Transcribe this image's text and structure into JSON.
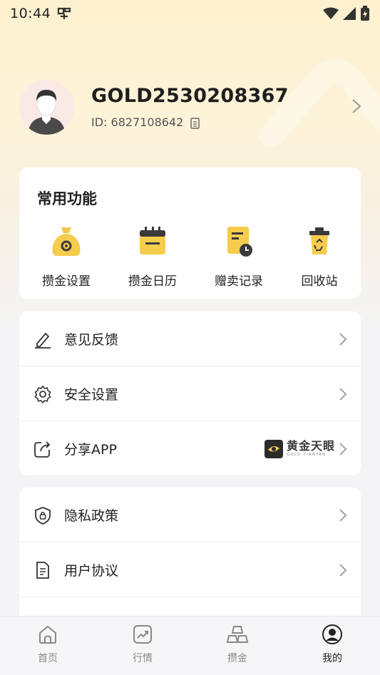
{
  "status": {
    "time": "10:44",
    "notif_icon": "app-notification-icon"
  },
  "profile": {
    "name": "GOLD2530208367",
    "id_text": "ID: 6827108642"
  },
  "common": {
    "title": "常用功能",
    "items": [
      {
        "label": "攒金设置",
        "icon": "money-bag-gear-icon"
      },
      {
        "label": "攒金日历",
        "icon": "calendar-icon"
      },
      {
        "label": "赠卖记录",
        "icon": "record-clock-icon"
      },
      {
        "label": "回收站",
        "icon": "recycle-bin-icon"
      }
    ]
  },
  "menu1": [
    {
      "label": "意见反馈",
      "icon": "pen-icon"
    },
    {
      "label": "安全设置",
      "icon": "gear-icon"
    },
    {
      "label": "分享APP",
      "icon": "share-icon",
      "brand": "黄金天眼",
      "brand_sub": "GOLD TIANYAN"
    }
  ],
  "menu2": [
    {
      "label": "隐私政策",
      "icon": "shield-lock-icon"
    },
    {
      "label": "用户协议",
      "icon": "document-icon"
    }
  ],
  "tabs": [
    {
      "label": "首页",
      "icon": "home-icon",
      "active": false
    },
    {
      "label": "行情",
      "icon": "chart-icon",
      "active": false
    },
    {
      "label": "攒金",
      "icon": "gold-bars-icon",
      "active": false
    },
    {
      "label": "我的",
      "icon": "user-icon",
      "active": true
    }
  ],
  "colors": {
    "accent": "#f3c84a",
    "text": "#222222",
    "muted": "#888888"
  }
}
